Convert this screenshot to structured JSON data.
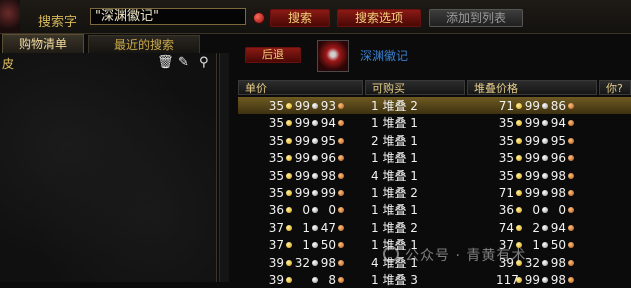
{
  "search": {
    "label": "搜索字",
    "value": "\"深渊徽记\""
  },
  "buttons": {
    "search": "搜索",
    "options": "搜索选项",
    "add": "添加到列表",
    "back": "后退"
  },
  "tabs": {
    "list": "购物清单",
    "recent": "最近的搜索"
  },
  "left_panel": {
    "first_item": "皮"
  },
  "item": {
    "name": "深渊徽记"
  },
  "table": {
    "headers": {
      "unit": "单价",
      "qty": "可购买",
      "stack": "堆叠价格",
      "q": "你?"
    },
    "rows": [
      {
        "u": [
          "35",
          "99",
          "93"
        ],
        "qty": "1 堆叠 2",
        "s": [
          "71",
          "99",
          "86"
        ],
        "selected": true
      },
      {
        "u": [
          "35",
          "99",
          "94"
        ],
        "qty": "1 堆叠 1",
        "s": [
          "35",
          "99",
          "94"
        ],
        "selected": false
      },
      {
        "u": [
          "35",
          "99",
          "95"
        ],
        "qty": "2 堆叠 1",
        "s": [
          "35",
          "99",
          "95"
        ],
        "selected": false
      },
      {
        "u": [
          "35",
          "99",
          "96"
        ],
        "qty": "1 堆叠 1",
        "s": [
          "35",
          "99",
          "96"
        ],
        "selected": false
      },
      {
        "u": [
          "35",
          "99",
          "98"
        ],
        "qty": "4 堆叠 1",
        "s": [
          "35",
          "99",
          "98"
        ],
        "selected": false
      },
      {
        "u": [
          "35",
          "99",
          "99"
        ],
        "qty": "1 堆叠 2",
        "s": [
          "71",
          "99",
          "98"
        ],
        "selected": false
      },
      {
        "u": [
          "36",
          "0",
          "0"
        ],
        "qty": "1 堆叠 1",
        "s": [
          "36",
          "0",
          "0"
        ],
        "selected": false
      },
      {
        "u": [
          "37",
          "1",
          "47"
        ],
        "qty": "1 堆叠 2",
        "s": [
          "74",
          "2",
          "94"
        ],
        "selected": false
      },
      {
        "u": [
          "37",
          "1",
          "50"
        ],
        "qty": "1 堆叠 1",
        "s": [
          "37",
          "1",
          "50"
        ],
        "selected": false
      },
      {
        "u": [
          "39",
          "32",
          "98"
        ],
        "qty": "4 堆叠 1",
        "s": [
          "39",
          "32",
          "98"
        ],
        "selected": false
      },
      {
        "u": [
          "39",
          "",
          "8"
        ],
        "qty": "1 堆叠 3",
        "s": [
          "117",
          "99",
          "98"
        ],
        "selected": false
      }
    ]
  },
  "watermark": "公众号 · 青黄有术",
  "colors": {
    "gold": "#d8a010",
    "silver": "#9a9a9a",
    "copper": "#b05a18",
    "selected_row": "#6e5a22"
  }
}
